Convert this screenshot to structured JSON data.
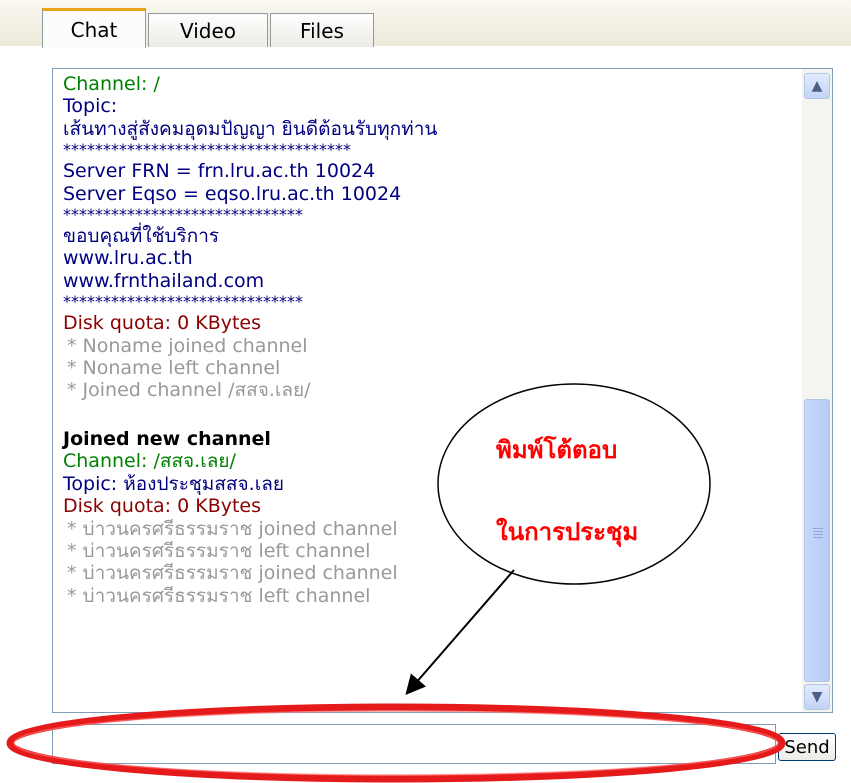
{
  "tabs": [
    {
      "label": "Chat",
      "active": true
    },
    {
      "label": "Video",
      "active": false
    },
    {
      "label": "Files",
      "active": false
    }
  ],
  "log": {
    "channel_line": "Channel: /",
    "topic_label": "Topic:",
    "topic_text": "เส้นทางสู่สังคมอุดมปัญญา ยินดีต้อนรับทุกท่าน",
    "sep1": "************************************",
    "server_frn": "Server FRN = frn.lru.ac.th 10024",
    "server_eqso": "Server Eqso = eqso.lru.ac.th 10024",
    "sep2": "******************************",
    "thanks": "ขอบคุณที่ใช้บริการ",
    "url1": "www.lru.ac.th",
    "url2": "www.frnthailand.com",
    "sep3": "******************************",
    "disk_quota_1": "Disk quota: 0 KBytes",
    "sys1": "* Noname joined channel",
    "sys2": "* Noname left channel",
    "sys3": "* Joined channel /สสจ.เลย/",
    "joined_header": "Joined new channel",
    "channel_line_2": "Channel: /สสจ.เลย/",
    "topic_line_2": "Topic: ห้องประชุมสสจ.เลย",
    "disk_quota_2": "Disk quota: 0 KBytes",
    "sys4": "* บ่าวนครศรีธรรมราช joined channel",
    "sys5": "* บ่าวนครศรีธรรมราช left channel",
    "sys6": "* บ่าวนครศรีธรรมราช joined channel",
    "sys7": "* บ่าวนครศรีธรรมราช left channel"
  },
  "input": {
    "value": ""
  },
  "send_label": "Send",
  "annotation": {
    "line1": "พิมพ์โต้ตอบ",
    "line2": "ในการประชุม",
    "color": "#ff0000"
  },
  "colors": {
    "channel": "#008000",
    "topic": "#000080",
    "quota": "#8b0000",
    "system": "#999999",
    "tab_accent": "#e8a317"
  }
}
